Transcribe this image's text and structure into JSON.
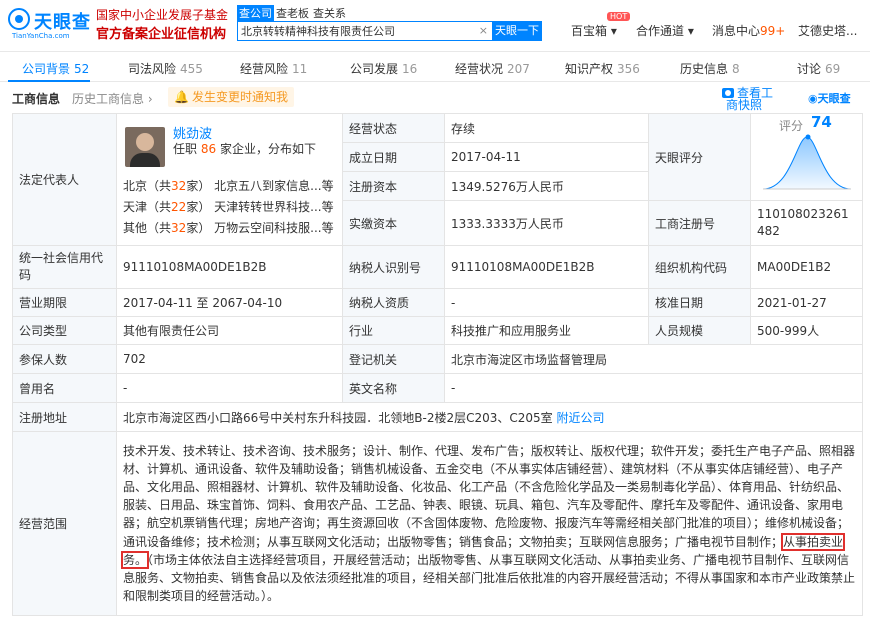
{
  "header": {
    "logo_text": "天眼查",
    "logo_sub": "TianYanCha.com",
    "ad_line1": "国家中小企业发展子基金",
    "ad_line2": "官方备案企业征信机构",
    "search_tabs": [
      "查公司",
      "查老板",
      "查关系"
    ],
    "search_value": "北京转转精神科技有限责任公司",
    "search_clear": "×",
    "search_button": "天眼一下",
    "nav": {
      "baobao": "百宝箱",
      "hot": "HOT",
      "partner": "合作通道",
      "messages": "消息中心",
      "message_count": "99+",
      "user": "艾德史塔..."
    }
  },
  "tabs": [
    {
      "label": "公司背景",
      "count": "52"
    },
    {
      "label": "司法风险",
      "count": "455"
    },
    {
      "label": "经营风险",
      "count": "11"
    },
    {
      "label": "公司发展",
      "count": "16"
    },
    {
      "label": "经营状况",
      "count": "207"
    },
    {
      "label": "知识产权",
      "count": "356"
    },
    {
      "label": "历史信息",
      "count": "8"
    },
    {
      "label": "讨论",
      "count": "69"
    }
  ],
  "subhead": {
    "title": "工商信息",
    "history": "历史工商信息",
    "notify": "发生变更时通知我",
    "report_line1": "查看工",
    "report_line2": "商快照",
    "brand": "天眼查"
  },
  "info": {
    "legal_rep_label": "法定代表人",
    "rep_name": "姚劲波",
    "rep_desc_prefix": "任职",
    "rep_desc_num": "86",
    "rep_desc_suffix": "家企业，分布如下",
    "rep_lines": [
      {
        "city": "北京",
        "count": "32",
        "company": "北京五八到家信息...等"
      },
      {
        "city": "天津",
        "count": "22",
        "company": "天津转转世界科技...等"
      },
      {
        "city": "其他",
        "count": "32",
        "company": "万物云空间科技服...等"
      }
    ],
    "status_label": "经营状态",
    "status": "存续",
    "founded_label": "成立日期",
    "founded": "2017-04-11",
    "reg_capital_label": "注册资本",
    "reg_capital": "1349.5276万人民币",
    "paid_capital_label": "实缴资本",
    "paid_capital": "1333.3333万人民币",
    "tianyan_score_label": "天眼评分",
    "score_word": "评分",
    "score": "74",
    "reg_no_label": "工商注册号",
    "reg_no": "110108023261482",
    "credit_code_label": "统一社会信用代码",
    "credit_code": "91110108MA00DE1B2B",
    "taxpayer_id_label": "纳税人识别号",
    "taxpayer_id": "91110108MA00DE1B2B",
    "org_code_label": "组织机构代码",
    "org_code": "MA00DE1B2",
    "term_label": "营业期限",
    "term": "2017-04-11  至 2067-04-10",
    "taxpayer_qual_label": "纳税人资质",
    "taxpayer_qual": "-",
    "approved_label": "核准日期",
    "approved": "2021-01-27",
    "type_label": "公司类型",
    "type": "其他有限责任公司",
    "industry_label": "行业",
    "industry": "科技推广和应用服务业",
    "staff_label": "人员规模",
    "staff": "500-999人",
    "insured_label": "参保人数",
    "insured": "702",
    "authority_label": "登记机关",
    "authority": "北京市海淀区市场监督管理局",
    "former_label": "曾用名",
    "former": "-",
    "english_label": "英文名称",
    "english": "-",
    "address_label": "注册地址",
    "address": "北京市海淀区西小口路66号中关村东升科技园．北领地B-2楼2层C203、C205室",
    "address_link": "附近公司",
    "scope_label": "经营范围",
    "scope_before": "技术开发、技术转让、技术咨询、技术服务；设计、制作、代理、发布广告；版权转让、版权代理；软件开发；委托生产电子产品、照相器材、计算机、通讯设备、软件及辅助设备；销售机械设备、五金交电（不从事实体店铺经营）、建筑材料（不从事实体店铺经营）、电子产品、文化用品、照相器材、计算机、软件及辅助设备、化妆品、化工产品（不含危险化学品及一类易制毒化学品）、体育用品、针纺织品、服装、日用品、珠宝首饰、饲料、食用农产品、工艺品、钟表、眼镜、玩具、箱包、汽车及零配件、摩托车及零配件、通讯设备、家用电器；航空机票销售代理；房地产咨询；再生资源回收（不含固体废物、危险废物、报废汽车等需经相关部门批准的项目）；维修机械设备；通讯设备维修；技术检测；从事互联网文化活动；出版物零售；销售食品；文物拍卖；互联网信息服务；广播电视节目制作；",
    "scope_highlight": "从事拍卖业务。",
    "scope_after": "（市场主体依法自主选择经营项目，开展经营活动；出版物零售、从事互联网文化活动、从事拍卖业务、广播电视节目制作、互联网信息服务、文物拍卖、销售食品以及依法须经批准的项目，经相关部门批准后依批准的内容开展经营活动；不得从事国家和本市产业政策禁止和限制类项目的经营活动。）。"
  },
  "colors": {
    "accent": "#0084ff",
    "highlight_box": "#e0302d",
    "count": "#ff5500"
  }
}
